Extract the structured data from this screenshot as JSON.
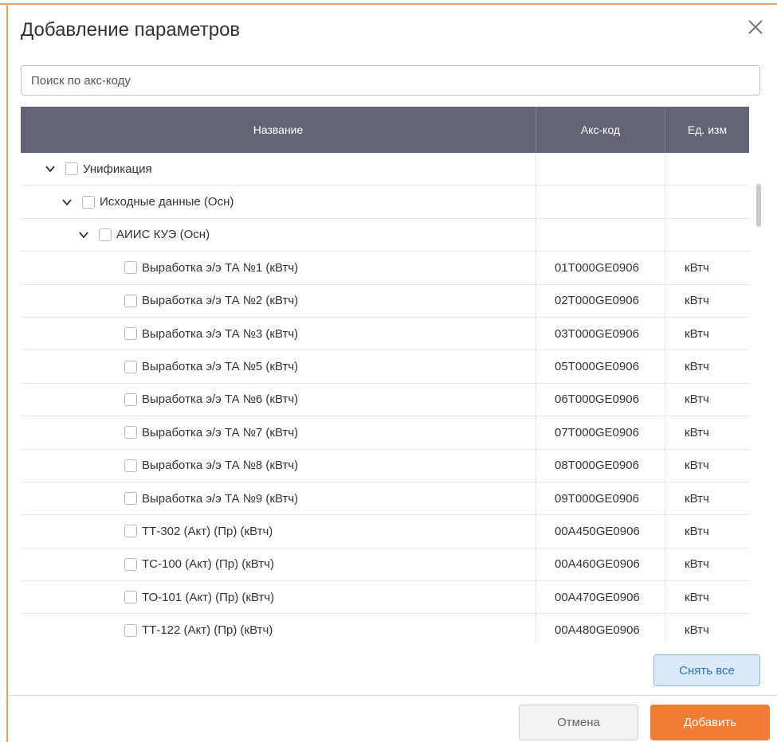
{
  "dialog": {
    "title": "Добавление параметров",
    "close_icon": "close-icon"
  },
  "search": {
    "placeholder": "Поиск по акс-коду",
    "value": ""
  },
  "table": {
    "columns": [
      "Название",
      "Акс-код",
      "Ед. изм"
    ],
    "rows": [
      {
        "level": 0,
        "expandable": true,
        "name": "Унификация",
        "code": "",
        "unit": ""
      },
      {
        "level": 1,
        "expandable": true,
        "name": "Исходные данные (Осн)",
        "code": "",
        "unit": ""
      },
      {
        "level": 2,
        "expandable": true,
        "name": "АИИС КУЭ (Осн)",
        "code": "",
        "unit": ""
      },
      {
        "level": 3,
        "expandable": false,
        "name": "Выработка э/э ТА №1 (кВтч)",
        "code": "01T000GE0906",
        "unit": "кВтч"
      },
      {
        "level": 3,
        "expandable": false,
        "name": "Выработка э/э ТА №2 (кВтч)",
        "code": "02T000GE0906",
        "unit": "кВтч"
      },
      {
        "level": 3,
        "expandable": false,
        "name": "Выработка э/э ТА №3 (кВтч)",
        "code": "03T000GE0906",
        "unit": "кВтч"
      },
      {
        "level": 3,
        "expandable": false,
        "name": "Выработка э/э ТА №5 (кВтч)",
        "code": "05T000GE0906",
        "unit": "кВтч"
      },
      {
        "level": 3,
        "expandable": false,
        "name": "Выработка э/э ТА №6 (кВтч)",
        "code": "06T000GE0906",
        "unit": "кВтч"
      },
      {
        "level": 3,
        "expandable": false,
        "name": "Выработка э/э ТА №7 (кВтч)",
        "code": "07T000GE0906",
        "unit": "кВтч"
      },
      {
        "level": 3,
        "expandable": false,
        "name": "Выработка э/э ТА №8 (кВтч)",
        "code": "08T000GE0906",
        "unit": "кВтч"
      },
      {
        "level": 3,
        "expandable": false,
        "name": "Выработка э/э ТА №9 (кВтч)",
        "code": "09T000GE0906",
        "unit": "кВтч"
      },
      {
        "level": 3,
        "expandable": false,
        "name": "ТТ-302 (Акт) (Пр) (кВтч)",
        "code": "00A450GE0906",
        "unit": "кВтч"
      },
      {
        "level": 3,
        "expandable": false,
        "name": "ТС-100 (Акт) (Пр) (кВтч)",
        "code": "00A460GE0906",
        "unit": "кВтч"
      },
      {
        "level": 3,
        "expandable": false,
        "name": "ТО-101 (Акт) (Пр) (кВтч)",
        "code": "00A470GE0906",
        "unit": "кВтч"
      },
      {
        "level": 3,
        "expandable": false,
        "name": "ТТ-122 (Акт) (Пр) (кВтч)",
        "code": "00A480GE0906",
        "unit": "кВтч"
      }
    ]
  },
  "buttons": {
    "clear_all": "Снять все",
    "cancel": "Отмена",
    "add": "Добавить"
  },
  "colors": {
    "header_bg": "#646373",
    "accent_orange": "#f07b35",
    "clear_button_bg": "#dbeafb",
    "clear_button_text": "#2d6fc0"
  }
}
